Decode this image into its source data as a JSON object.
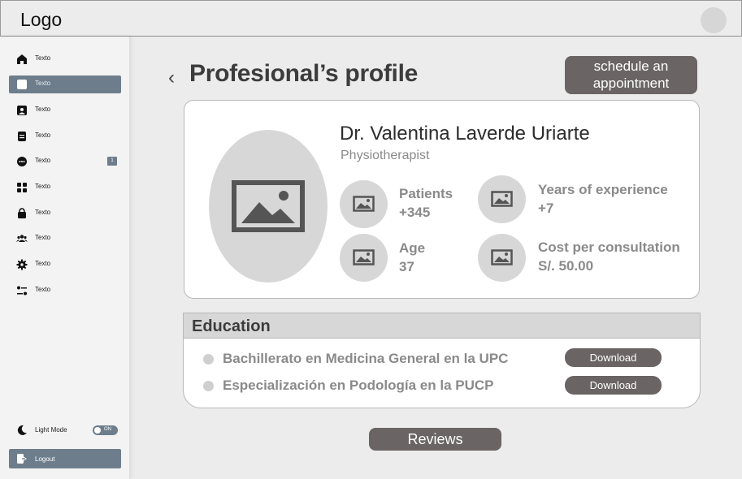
{
  "header": {
    "logo": "Logo"
  },
  "sidebar": {
    "items": [
      {
        "label": "Texto",
        "icon": "home-icon"
      },
      {
        "label": "Texto",
        "icon": "edit-icon",
        "active": true
      },
      {
        "label": "Texto",
        "icon": "portrait-icon"
      },
      {
        "label": "Texto",
        "icon": "document-icon"
      },
      {
        "label": "Texto",
        "icon": "chat-icon",
        "badge": "1"
      },
      {
        "label": "Texto",
        "icon": "grid-icon"
      },
      {
        "label": "Texto",
        "icon": "bag-icon"
      },
      {
        "label": "Texto",
        "icon": "people-icon"
      },
      {
        "label": "Texto",
        "icon": "gear-icon"
      },
      {
        "label": "Texto",
        "icon": "sliders-icon"
      }
    ],
    "light_mode_label": "Light Mode",
    "toggle_label": "ON",
    "logout_label": "Logout"
  },
  "page": {
    "back_icon": "‹",
    "title": "Profesional’s profile",
    "schedule_button": "schedule an appointment"
  },
  "profile": {
    "name": "Dr. Valentina Laverde Uriarte",
    "role": "Physiotherapist",
    "stats": [
      {
        "label": "Patients",
        "value": "+345"
      },
      {
        "label": "Years of experience",
        "value": "+7"
      },
      {
        "label": "Age",
        "value": "37"
      },
      {
        "label": "Cost per consultation",
        "value": "S/. 50.00"
      }
    ]
  },
  "education": {
    "title": "Education",
    "items": [
      {
        "text": "Bachillerato en Medicina General en la UPC",
        "button": "Download"
      },
      {
        "text": "Especialización en Podología en la PUCP",
        "button": "Download"
      }
    ]
  },
  "reviews_button": "Reviews",
  "colors": {
    "accent": "#6d7d8c",
    "button": "#6a6464",
    "placeholder": "#d7d7d7"
  }
}
